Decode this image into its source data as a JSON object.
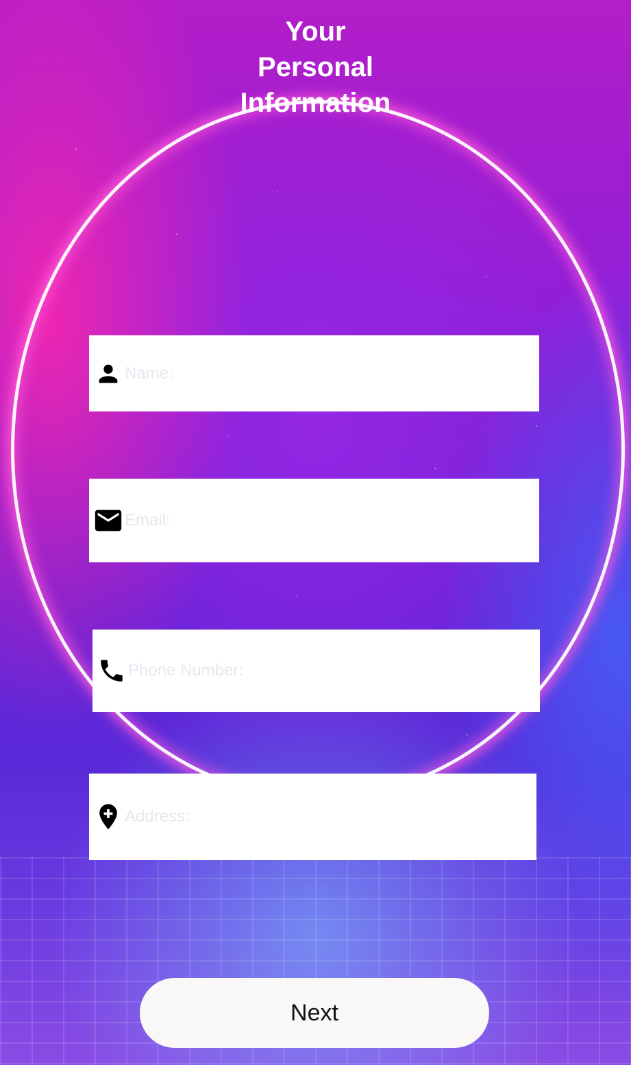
{
  "header": {
    "title_lines": [
      "Your",
      "Personal",
      "Information"
    ]
  },
  "form": {
    "name": {
      "placeholder": "Name:",
      "value": "",
      "icon": "person-icon"
    },
    "email": {
      "placeholder": "Email:",
      "value": "",
      "icon": "mail-icon"
    },
    "phone": {
      "placeholder": "Phone Number:",
      "value": "",
      "icon": "phone-icon"
    },
    "address": {
      "placeholder": "Address:",
      "value": "",
      "icon": "location-add-icon"
    }
  },
  "actions": {
    "next_label": "Next"
  },
  "colors": {
    "field_background": "#ffffff",
    "placeholder": "#e9e6ef",
    "button_background": "#faf8f6",
    "title_text": "#ffffff"
  }
}
